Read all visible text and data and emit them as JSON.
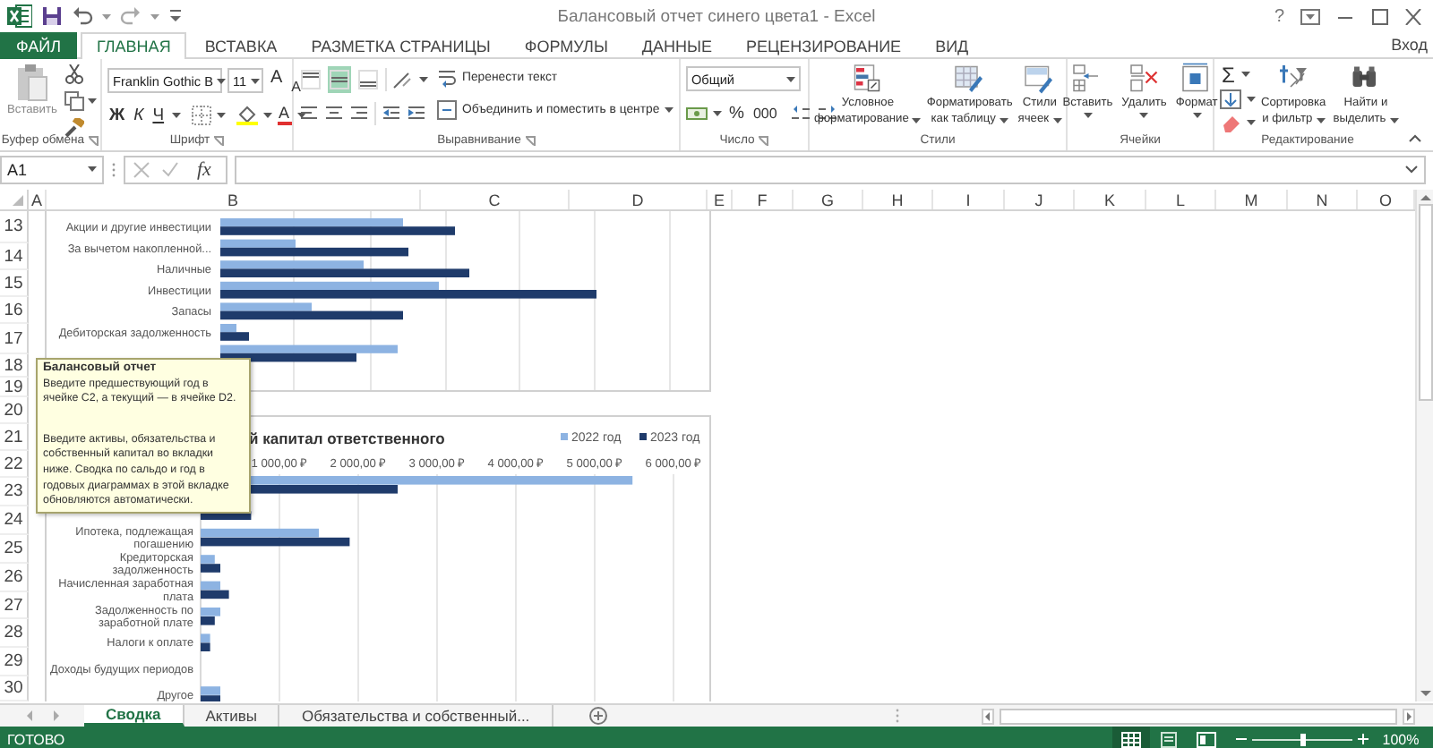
{
  "title_bar": {
    "title": "Балансовый отчет синего цвета1 - Excel",
    "help": "?"
  },
  "ribbon_tabs": [
    {
      "label": "ФАЙЛ",
      "kind": "file",
      "selected": false
    },
    {
      "label": "ГЛАВНАЯ",
      "kind": "tab",
      "selected": true
    },
    {
      "label": "ВСТАВКА",
      "kind": "tab",
      "selected": false
    },
    {
      "label": "РАЗМЕТКА СТРАНИЦЫ",
      "kind": "tab",
      "selected": false
    },
    {
      "label": "ФОРМУЛЫ",
      "kind": "tab",
      "selected": false
    },
    {
      "label": "ДАННЫЕ",
      "kind": "tab",
      "selected": false
    },
    {
      "label": "РЕЦЕНЗИРОВАНИЕ",
      "kind": "tab",
      "selected": false
    },
    {
      "label": "ВИД",
      "kind": "tab",
      "selected": false
    }
  ],
  "sign_in": "Вход",
  "ribbon": {
    "groups": [
      {
        "kind": "clipboard",
        "label": "Буфер обмена",
        "paste": "Вставить"
      },
      {
        "kind": "font",
        "label": "Шрифт",
        "font_name": "Franklin Gothic B",
        "font_size": "11",
        "grow": "A",
        "shrink": "A",
        "bold": "Ж",
        "italic": "К",
        "underline": "Ч",
        "font_color": "A"
      },
      {
        "kind": "alignment",
        "label": "Выравнивание",
        "vertical_align": [
          {
            "selected": false
          },
          {
            "selected": true
          },
          {
            "selected": false
          }
        ],
        "wrap_text": "Перенести текст",
        "merge": "Объединить и поместить в центре"
      },
      {
        "kind": "number",
        "label": "Число",
        "format": "Общий",
        "percent": "%",
        "thousands": "000"
      },
      {
        "kind": "styles",
        "label": "Стили",
        "buttons": [
          {
            "lines": [
              "Условное",
              "форматирование"
            ]
          },
          {
            "lines": [
              "Форматировать",
              "как таблицу"
            ]
          },
          {
            "lines": [
              "Стили",
              "ячеек"
            ]
          }
        ]
      },
      {
        "kind": "cells",
        "label": "Ячейки",
        "buttons": [
          {
            "lines": [
              "Вставить"
            ]
          },
          {
            "lines": [
              "Удалить"
            ]
          },
          {
            "lines": [
              "Формат"
            ]
          }
        ]
      },
      {
        "kind": "editing",
        "label": "Редактирование",
        "autosum": "Σ",
        "buttons": [
          {
            "lines": [
              "Сортировка",
              "и фильтр"
            ]
          },
          {
            "lines": [
              "Найти и",
              "выделить"
            ]
          }
        ]
      }
    ]
  },
  "formula_bar": {
    "name_box": "A1",
    "function_label": "fx"
  },
  "sheet": {
    "columns": [
      "A",
      "B",
      "C",
      "D",
      "E",
      "F",
      "G",
      "H",
      "I",
      "J",
      "K",
      "L",
      "M",
      "N",
      "O"
    ],
    "rows": [
      "13",
      "14",
      "15",
      "16",
      "17",
      "18",
      "19",
      "20",
      "21",
      "22",
      "23",
      "24",
      "25",
      "26",
      "27",
      "28",
      "29",
      "30"
    ],
    "chart_1": {
      "categories": [
        "Акции и другие инвестиции",
        "За вычетом накопленной...",
        "Наличные",
        "Инвестиции",
        "Запасы",
        "Дебиторская задолженность"
      ]
    },
    "chart_2": {
      "chart_data": {
        "type": "bar",
        "orientation": "horizontal",
        "title": "й капитал ответственного",
        "categories": [
          null,
          null,
          "Ипотека, подлежащая погашению",
          "Кредиторская задолженность",
          "Начисленная заработная плата",
          "Задолженность по заработной плате",
          "Налоги к оплате",
          "Доходы будущих периодов",
          "Другое"
        ],
        "series": [
          {
            "name": "2022 год",
            "color": "#8db3e2",
            "values": [
              5480,
              null,
              1500,
              180,
              250,
              250,
              120,
              0,
              250
            ]
          },
          {
            "name": "2023 год",
            "color": "#1f3b6b",
            "values": [
              2500,
              640,
              1890,
              250,
              360,
              180,
              120,
              0,
              250
            ]
          }
        ],
        "xlim": [
          0,
          6000
        ],
        "grid": true,
        "legend": true,
        "xticks": [
          {
            "value": 1000,
            "label": "1 000,00 ₽"
          },
          {
            "value": 2000,
            "label": "2 000,00 ₽"
          },
          {
            "value": 3000,
            "label": "3 000,00 ₽"
          },
          {
            "value": 4000,
            "label": "4 000,00 ₽"
          },
          {
            "value": 5000,
            "label": "5 000,00 ₽"
          },
          {
            "value": 6000,
            "label": "6 000,00 ₽"
          }
        ]
      }
    },
    "tooltip": {
      "title": "Балансовый отчет",
      "paragraphs": [
        "Введите предшествующий год в ячейке C2, а текущий — в ячейке D2.",
        "Введите активы, обязательства и собственный капитал во вкладки ниже. Сводка по сальдо и год в годовых диаграммах в этой вкладке обновляются автоматически."
      ]
    }
  },
  "sheet_tabs": [
    {
      "label": "Сводка",
      "selected": true
    },
    {
      "label": "Активы",
      "selected": false
    },
    {
      "label": "Обязательства и собственный...",
      "selected": false
    }
  ],
  "status_bar": {
    "status": "ГОТОВО",
    "views": [
      {
        "selected": true
      },
      {
        "selected": false
      },
      {
        "selected": false
      }
    ],
    "zoom": {
      "level": 0.5,
      "reading": "100%"
    }
  }
}
